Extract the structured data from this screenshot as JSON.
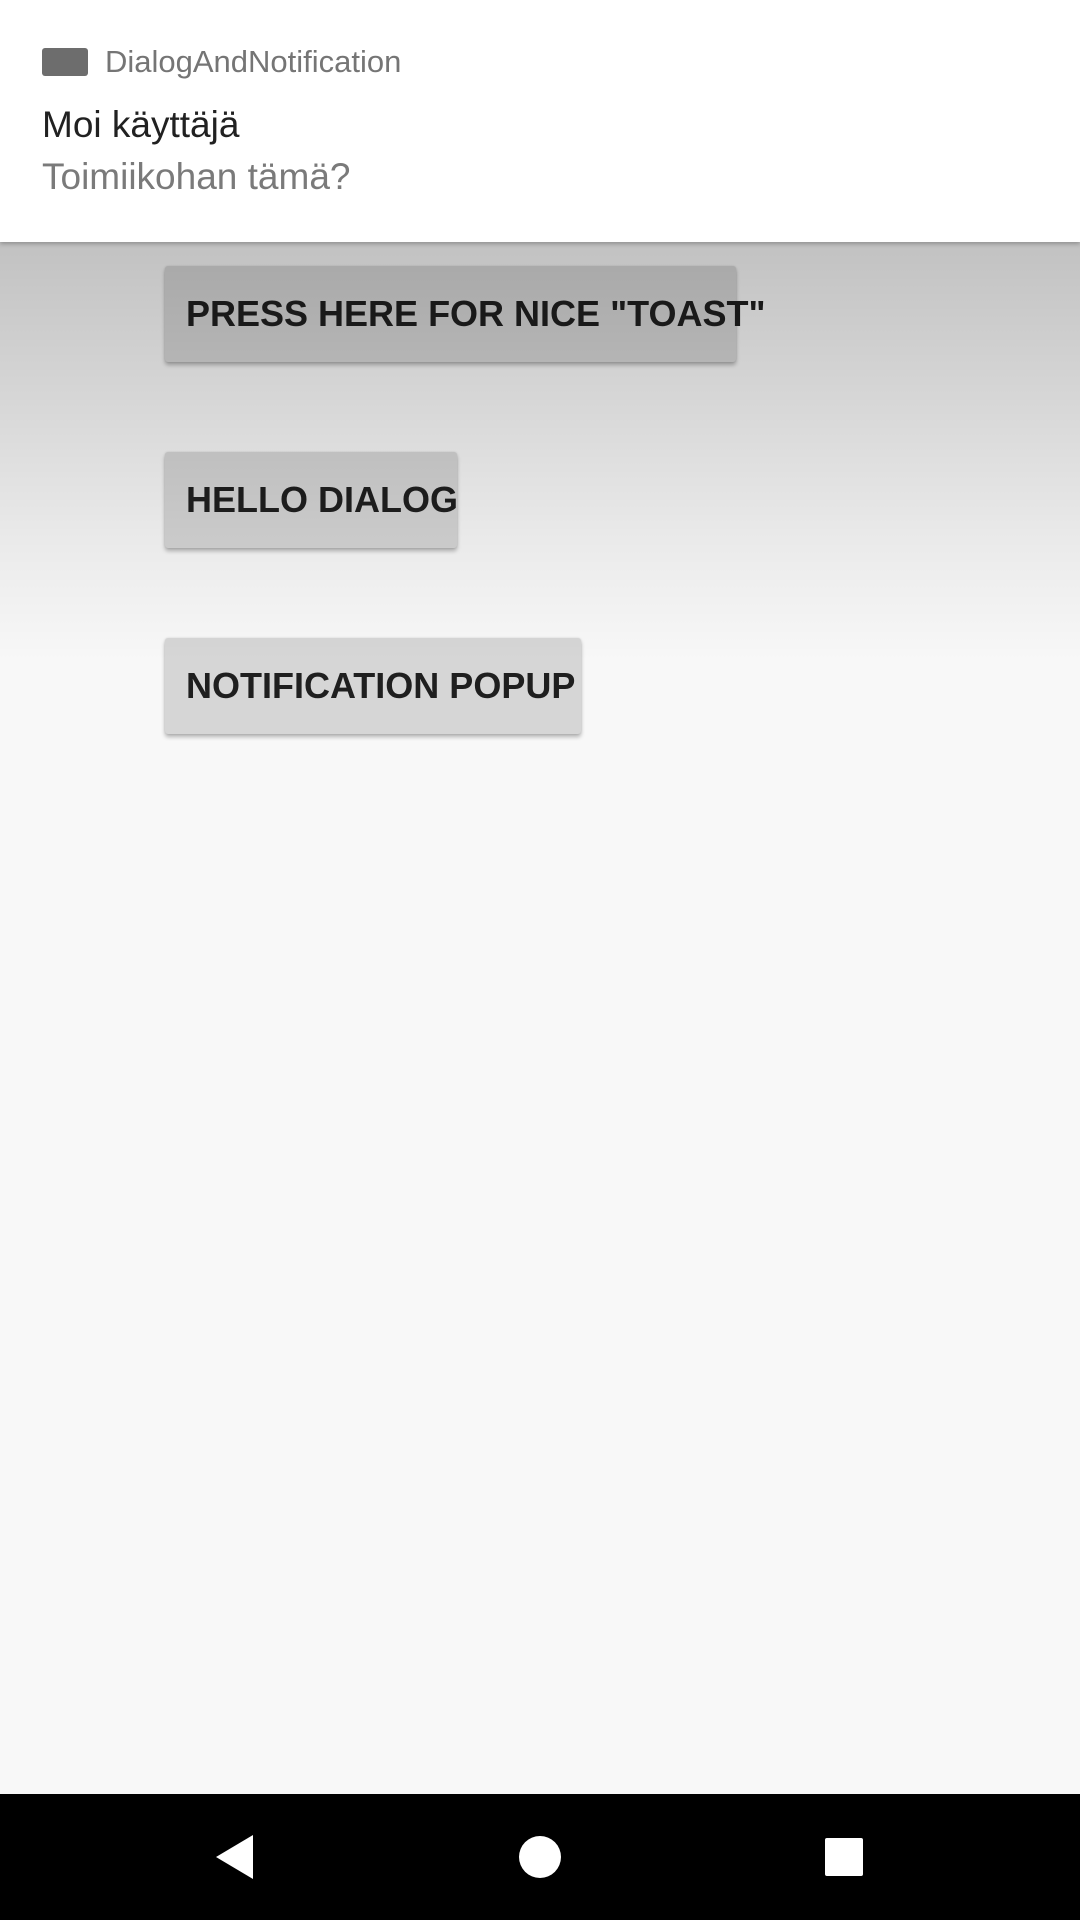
{
  "notification": {
    "app_name": "DialogAndNotification",
    "title": "Moi käyttäjä",
    "text": "Toimiikohan tämä?",
    "icon": "app-icon"
  },
  "buttons": {
    "toast_label": "PRESS HERE FOR NICE \"TOAST\"",
    "dialog_label": "HELLO DIALOG",
    "notification_label": "NOTIFICATION POPUP"
  },
  "navbar": {
    "back_icon": "back-icon",
    "home_icon": "home-icon",
    "recents_icon": "recents-icon"
  },
  "colors": {
    "button_bg": "#d6d6d6",
    "app_bg": "#f8f8f8",
    "notification_bg": "#ffffff",
    "navbar_bg": "#000000"
  }
}
